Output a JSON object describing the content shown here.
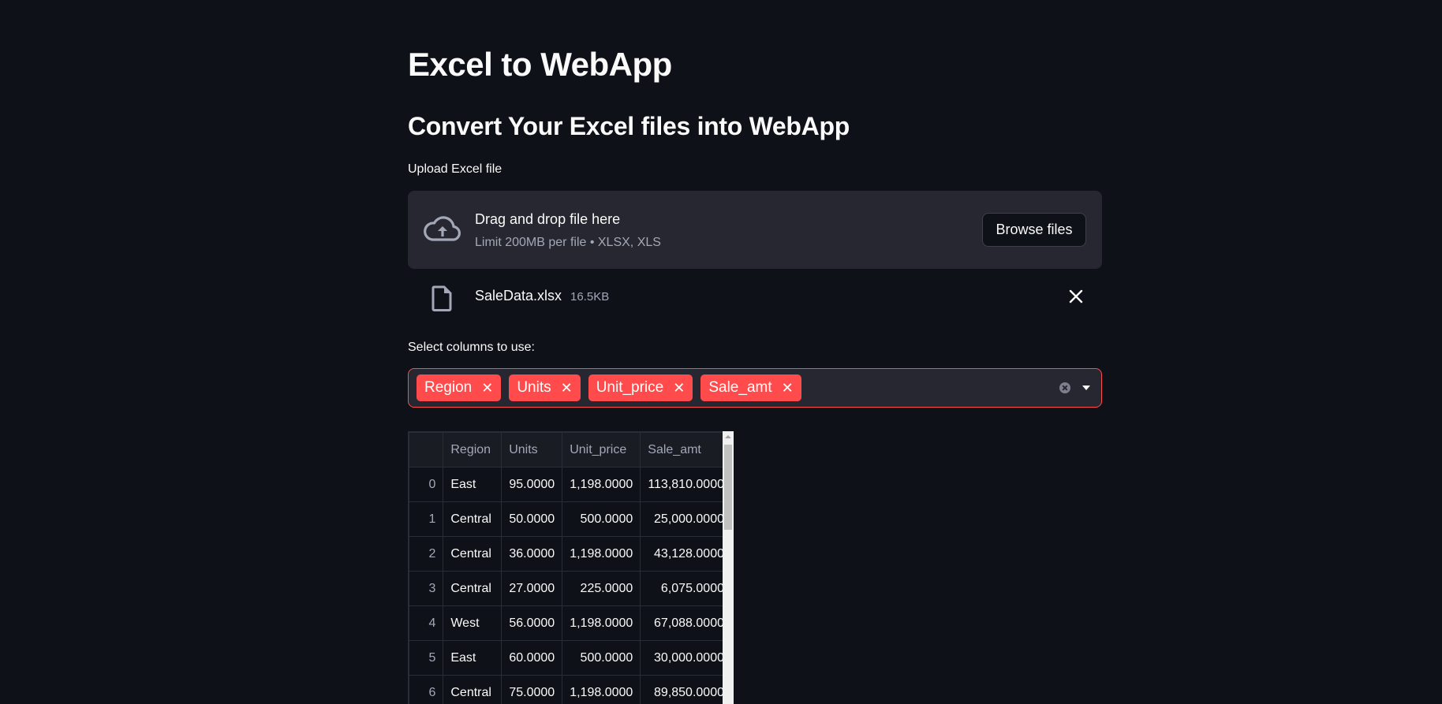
{
  "title": "Excel to WebApp",
  "subtitle": "Convert Your Excel files into WebApp",
  "uploader": {
    "label": "Upload Excel file",
    "drop_title": "Drag and drop file here",
    "limit_text": "Limit 200MB per file • XLSX, XLS",
    "browse_label": "Browse files",
    "icon": "cloud-upload-icon"
  },
  "uploaded_file": {
    "name": "SaleData.xlsx",
    "size": "16.5KB",
    "icon": "file-icon",
    "remove_icon": "close-icon"
  },
  "column_select": {
    "label": "Select columns to use:",
    "selected": [
      "Region",
      "Units",
      "Unit_price",
      "Sale_amt"
    ],
    "remove_glyph": "✕",
    "accent_color": "#ff4b4b"
  },
  "table": {
    "columns": [
      "",
      "Region",
      "Units",
      "Unit_price",
      "Sale_amt"
    ],
    "rows": [
      [
        "0",
        "East",
        "95.0000",
        "1,198.0000",
        "113,810.0000"
      ],
      [
        "1",
        "Central",
        "50.0000",
        "500.0000",
        "25,000.0000"
      ],
      [
        "2",
        "Central",
        "36.0000",
        "1,198.0000",
        "43,128.0000"
      ],
      [
        "3",
        "Central",
        "27.0000",
        "225.0000",
        "6,075.0000"
      ],
      [
        "4",
        "West",
        "56.0000",
        "1,198.0000",
        "67,088.0000"
      ],
      [
        "5",
        "East",
        "60.0000",
        "500.0000",
        "30,000.0000"
      ],
      [
        "6",
        "Central",
        "75.0000",
        "1,198.0000",
        "89,850.0000"
      ]
    ]
  },
  "colors": {
    "background": "#0e1117",
    "surface": "#262730",
    "accent": "#ff4b4b",
    "text": "#fafafa",
    "muted_text": "#a3a8b8"
  }
}
